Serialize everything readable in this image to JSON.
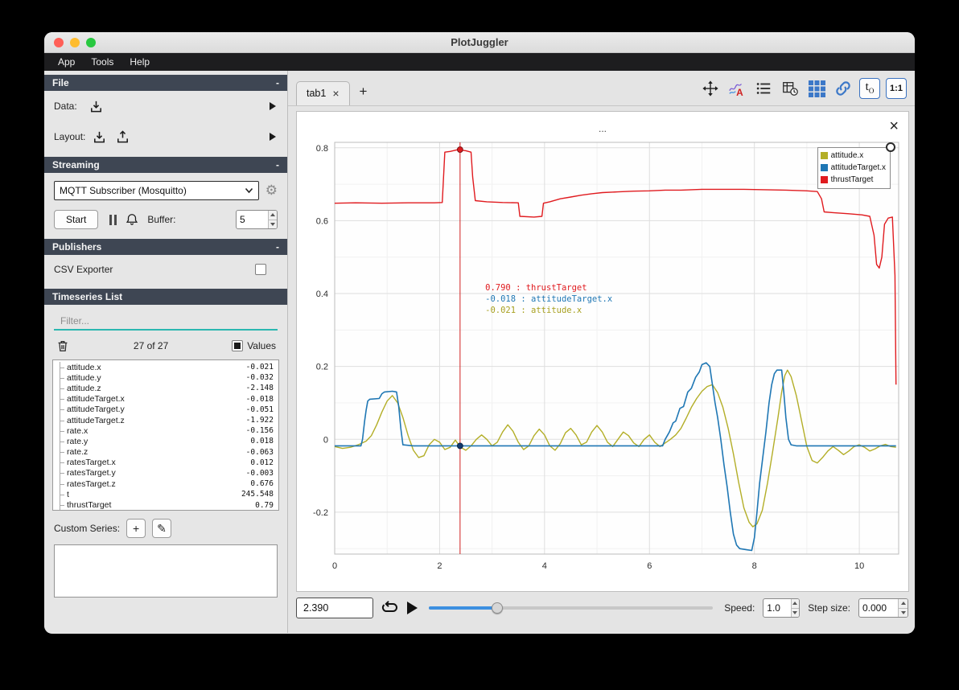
{
  "window": {
    "title": "PlotJuggler"
  },
  "menu": {
    "items": [
      "App",
      "Tools",
      "Help"
    ]
  },
  "ui": {
    "gear": "⚙",
    "pencil": "✎",
    "plus": "+",
    "close": "×",
    "collapse": "-"
  },
  "sidebar": {
    "file": {
      "title": "File",
      "collapse": "-",
      "data_label": "Data:",
      "layout_label": "Layout:"
    },
    "streaming": {
      "title": "Streaming",
      "collapse": "-",
      "source": "MQTT Subscriber (Mosquitto)",
      "start_button": "Start",
      "buffer_label": "Buffer:",
      "buffer_value": "5"
    },
    "publishers": {
      "title": "Publishers",
      "collapse": "-",
      "csv_label": "CSV Exporter"
    },
    "timeseries": {
      "title": "Timeseries List",
      "filter_placeholder": "Filter...",
      "count_label": "27 of 27",
      "values_label": "Values",
      "custom_label": "Custom Series:",
      "items": [
        {
          "name": "attitude.x",
          "value": "-0.021"
        },
        {
          "name": "attitude.y",
          "value": "-0.032"
        },
        {
          "name": "attitude.z",
          "value": "-2.148"
        },
        {
          "name": "attitudeTarget.x",
          "value": "-0.018"
        },
        {
          "name": "attitudeTarget.y",
          "value": "-0.051"
        },
        {
          "name": "attitudeTarget.z",
          "value": "-1.922"
        },
        {
          "name": "rate.x",
          "value": "-0.156"
        },
        {
          "name": "rate.y",
          "value": "0.018"
        },
        {
          "name": "rate.z",
          "value": "-0.063"
        },
        {
          "name": "ratesTarget.x",
          "value": "0.012"
        },
        {
          "name": "ratesTarget.y",
          "value": "-0.003"
        },
        {
          "name": "ratesTarget.z",
          "value": "0.676"
        },
        {
          "name": "t",
          "value": "245.548"
        },
        {
          "name": "thrustTarget",
          "value": "0.79"
        }
      ]
    }
  },
  "main": {
    "tab": {
      "label": "tab1",
      "close_label": "×"
    },
    "add_tab_label": "+",
    "toolbar": {
      "t_label": "t",
      "t_sub": "O",
      "ratio_label": "1:1"
    },
    "plot": {
      "title_text": "...",
      "close_label": "×"
    },
    "playback": {
      "time_value": "2.390",
      "speed_label": "Speed:",
      "speed_value": "1.0",
      "step_label": "Step size:",
      "step_value": "0.000",
      "slider_fraction": 0.24
    }
  },
  "chart_data": {
    "type": "line",
    "title": "...",
    "xlabel": "",
    "ylabel": "",
    "xlim": [
      0,
      10.75
    ],
    "ylim": [
      -0.315,
      0.815
    ],
    "xticks": [
      0,
      2,
      4,
      6,
      8,
      10
    ],
    "yticks": [
      0.8,
      0.6,
      0.4,
      0.2,
      0,
      -0.2
    ],
    "xticks_minor": [
      1,
      3,
      5,
      7,
      9
    ],
    "yticks_minor": [
      0.7,
      0.5,
      0.3,
      0.1,
      -0.1,
      -0.3
    ],
    "grid": true,
    "legend_position": "top-right",
    "series": [
      {
        "name": "attitude.x",
        "color": "#b3ae27",
        "width": 1.4,
        "points": [
          [
            0,
            -0.02
          ],
          [
            0.15,
            -0.025
          ],
          [
            0.3,
            -0.022
          ],
          [
            0.45,
            -0.015
          ],
          [
            0.6,
            -0.005
          ],
          [
            0.7,
            0.01
          ],
          [
            0.8,
            0.04
          ],
          [
            0.9,
            0.075
          ],
          [
            1.0,
            0.105
          ],
          [
            1.1,
            0.12
          ],
          [
            1.2,
            0.1
          ],
          [
            1.3,
            0.06
          ],
          [
            1.4,
            0.01
          ],
          [
            1.5,
            -0.03
          ],
          [
            1.6,
            -0.05
          ],
          [
            1.7,
            -0.045
          ],
          [
            1.8,
            -0.015
          ],
          [
            1.9,
            0.0
          ],
          [
            2.0,
            -0.008
          ],
          [
            2.1,
            -0.028
          ],
          [
            2.2,
            -0.022
          ],
          [
            2.3,
            -0.002
          ],
          [
            2.39,
            -0.021
          ],
          [
            2.5,
            -0.03
          ],
          [
            2.6,
            -0.018
          ],
          [
            2.7,
            0.0
          ],
          [
            2.8,
            0.012
          ],
          [
            2.9,
            0.0
          ],
          [
            3.0,
            -0.018
          ],
          [
            3.1,
            -0.008
          ],
          [
            3.2,
            0.02
          ],
          [
            3.3,
            0.04
          ],
          [
            3.4,
            0.022
          ],
          [
            3.5,
            -0.008
          ],
          [
            3.6,
            -0.028
          ],
          [
            3.7,
            -0.018
          ],
          [
            3.8,
            0.01
          ],
          [
            3.9,
            0.028
          ],
          [
            4.0,
            0.012
          ],
          [
            4.1,
            -0.018
          ],
          [
            4.2,
            -0.03
          ],
          [
            4.3,
            -0.012
          ],
          [
            4.4,
            0.018
          ],
          [
            4.5,
            0.03
          ],
          [
            4.6,
            0.012
          ],
          [
            4.7,
            -0.015
          ],
          [
            4.8,
            -0.008
          ],
          [
            4.9,
            0.02
          ],
          [
            5.0,
            0.038
          ],
          [
            5.1,
            0.02
          ],
          [
            5.2,
            -0.008
          ],
          [
            5.3,
            -0.02
          ],
          [
            5.4,
            0.0
          ],
          [
            5.5,
            0.02
          ],
          [
            5.6,
            0.01
          ],
          [
            5.7,
            -0.01
          ],
          [
            5.8,
            -0.02
          ],
          [
            5.9,
            0.0
          ],
          [
            6.0,
            0.012
          ],
          [
            6.1,
            -0.008
          ],
          [
            6.2,
            -0.02
          ],
          [
            6.3,
            -0.01
          ],
          [
            6.4,
            0.0
          ],
          [
            6.5,
            0.012
          ],
          [
            6.6,
            0.03
          ],
          [
            6.7,
            0.058
          ],
          [
            6.8,
            0.088
          ],
          [
            6.9,
            0.112
          ],
          [
            7.0,
            0.132
          ],
          [
            7.1,
            0.145
          ],
          [
            7.2,
            0.15
          ],
          [
            7.3,
            0.128
          ],
          [
            7.4,
            0.088
          ],
          [
            7.5,
            0.03
          ],
          [
            7.6,
            -0.04
          ],
          [
            7.7,
            -0.118
          ],
          [
            7.8,
            -0.188
          ],
          [
            7.9,
            -0.228
          ],
          [
            7.97,
            -0.24
          ],
          [
            8.05,
            -0.232
          ],
          [
            8.15,
            -0.195
          ],
          [
            8.25,
            -0.12
          ],
          [
            8.35,
            -0.032
          ],
          [
            8.45,
            0.06
          ],
          [
            8.52,
            0.13
          ],
          [
            8.58,
            0.175
          ],
          [
            8.63,
            0.19
          ],
          [
            8.7,
            0.172
          ],
          [
            8.8,
            0.12
          ],
          [
            8.9,
            0.05
          ],
          [
            9.0,
            -0.02
          ],
          [
            9.1,
            -0.058
          ],
          [
            9.2,
            -0.065
          ],
          [
            9.3,
            -0.05
          ],
          [
            9.4,
            -0.032
          ],
          [
            9.5,
            -0.02
          ],
          [
            9.6,
            -0.03
          ],
          [
            9.7,
            -0.042
          ],
          [
            9.8,
            -0.032
          ],
          [
            9.9,
            -0.02
          ],
          [
            10.0,
            -0.015
          ],
          [
            10.1,
            -0.022
          ],
          [
            10.2,
            -0.032
          ],
          [
            10.3,
            -0.026
          ],
          [
            10.4,
            -0.018
          ],
          [
            10.5,
            -0.014
          ],
          [
            10.6,
            -0.02
          ],
          [
            10.7,
            -0.022
          ]
        ]
      },
      {
        "name": "attitudeTarget.x",
        "color": "#1f77b4",
        "width": 1.6,
        "points": [
          [
            0,
            -0.018
          ],
          [
            0.5,
            -0.018
          ],
          [
            0.53,
            0.0
          ],
          [
            0.57,
            0.05
          ],
          [
            0.6,
            0.08
          ],
          [
            0.63,
            0.105
          ],
          [
            0.67,
            0.11
          ],
          [
            0.85,
            0.112
          ],
          [
            0.9,
            0.125
          ],
          [
            0.95,
            0.13
          ],
          [
            1.1,
            0.132
          ],
          [
            1.18,
            0.13
          ],
          [
            1.22,
            0.09
          ],
          [
            1.26,
            0.03
          ],
          [
            1.3,
            -0.015
          ],
          [
            1.5,
            -0.018
          ],
          [
            2.5,
            -0.018
          ],
          [
            3.5,
            -0.018
          ],
          [
            4.5,
            -0.018
          ],
          [
            5.5,
            -0.018
          ],
          [
            6.25,
            -0.018
          ],
          [
            6.3,
            0.0
          ],
          [
            6.38,
            0.02
          ],
          [
            6.45,
            0.045
          ],
          [
            6.5,
            0.05
          ],
          [
            6.58,
            0.085
          ],
          [
            6.65,
            0.09
          ],
          [
            6.73,
            0.13
          ],
          [
            6.8,
            0.14
          ],
          [
            6.88,
            0.17
          ],
          [
            6.95,
            0.185
          ],
          [
            7.0,
            0.205
          ],
          [
            7.08,
            0.21
          ],
          [
            7.15,
            0.2
          ],
          [
            7.2,
            0.15
          ],
          [
            7.25,
            0.1
          ],
          [
            7.3,
            0.06
          ],
          [
            7.36,
            0.0
          ],
          [
            7.42,
            -0.07
          ],
          [
            7.48,
            -0.13
          ],
          [
            7.54,
            -0.2
          ],
          [
            7.6,
            -0.26
          ],
          [
            7.66,
            -0.29
          ],
          [
            7.72,
            -0.3
          ],
          [
            7.85,
            -0.303
          ],
          [
            7.95,
            -0.305
          ],
          [
            8.0,
            -0.27
          ],
          [
            8.05,
            -0.2
          ],
          [
            8.1,
            -0.12
          ],
          [
            8.16,
            -0.05
          ],
          [
            8.22,
            0.02
          ],
          [
            8.28,
            0.1
          ],
          [
            8.33,
            0.15
          ],
          [
            8.38,
            0.18
          ],
          [
            8.43,
            0.19
          ],
          [
            8.52,
            0.19
          ],
          [
            8.56,
            0.13
          ],
          [
            8.6,
            0.06
          ],
          [
            8.65,
            0.0
          ],
          [
            8.7,
            -0.015
          ],
          [
            8.8,
            -0.018
          ],
          [
            9.5,
            -0.018
          ],
          [
            10.2,
            -0.018
          ],
          [
            10.7,
            -0.018
          ]
        ]
      },
      {
        "name": "thrustTarget",
        "color": "#e01b1f",
        "width": 1.4,
        "points": [
          [
            0,
            0.648
          ],
          [
            0.4,
            0.649
          ],
          [
            0.9,
            0.648
          ],
          [
            1.4,
            0.649
          ],
          [
            1.9,
            0.649
          ],
          [
            2.05,
            0.65
          ],
          [
            2.1,
            0.788
          ],
          [
            2.2,
            0.79
          ],
          [
            2.35,
            0.795
          ],
          [
            2.5,
            0.792
          ],
          [
            2.6,
            0.788
          ],
          [
            2.63,
            0.72
          ],
          [
            2.68,
            0.655
          ],
          [
            2.9,
            0.652
          ],
          [
            3.2,
            0.65
          ],
          [
            3.5,
            0.649
          ],
          [
            3.53,
            0.612
          ],
          [
            3.8,
            0.61
          ],
          [
            3.95,
            0.612
          ],
          [
            3.98,
            0.648
          ],
          [
            4.1,
            0.652
          ],
          [
            4.3,
            0.66
          ],
          [
            4.5,
            0.665
          ],
          [
            4.7,
            0.67
          ],
          [
            4.9,
            0.674
          ],
          [
            5.1,
            0.677
          ],
          [
            5.4,
            0.679
          ],
          [
            5.7,
            0.681
          ],
          [
            6.0,
            0.682
          ],
          [
            6.3,
            0.684
          ],
          [
            6.6,
            0.684
          ],
          [
            7.0,
            0.686
          ],
          [
            7.4,
            0.686
          ],
          [
            7.8,
            0.686
          ],
          [
            8.2,
            0.685
          ],
          [
            8.6,
            0.684
          ],
          [
            9.0,
            0.682
          ],
          [
            9.2,
            0.68
          ],
          [
            9.28,
            0.66
          ],
          [
            9.33,
            0.624
          ],
          [
            9.5,
            0.622
          ],
          [
            9.8,
            0.619
          ],
          [
            10.05,
            0.616
          ],
          [
            10.2,
            0.612
          ],
          [
            10.28,
            0.56
          ],
          [
            10.33,
            0.48
          ],
          [
            10.38,
            0.47
          ],
          [
            10.43,
            0.5
          ],
          [
            10.48,
            0.59
          ],
          [
            10.55,
            0.607
          ],
          [
            10.63,
            0.61
          ],
          [
            10.68,
            0.45
          ],
          [
            10.7,
            0.15
          ]
        ]
      }
    ],
    "tracker": {
      "x": 2.39,
      "markers": [
        {
          "y": 0.795,
          "fill": "#e01b1f",
          "stroke": "#7c0d10"
        },
        {
          "y": -0.018,
          "fill": "#123a6d",
          "stroke": "#0a2547"
        }
      ],
      "annotation": {
        "x": 2.87,
        "y": 0.409,
        "line_height_px": 14,
        "lines": [
          {
            "text": " 0.790 : thrustTarget",
            "color": "#e01b1f"
          },
          {
            "text": "-0.018 : attitudeTarget.x",
            "color": "#1f77b4"
          },
          {
            "text": "-0.021 : attitude.x",
            "color": "#a8a020"
          }
        ]
      }
    }
  }
}
